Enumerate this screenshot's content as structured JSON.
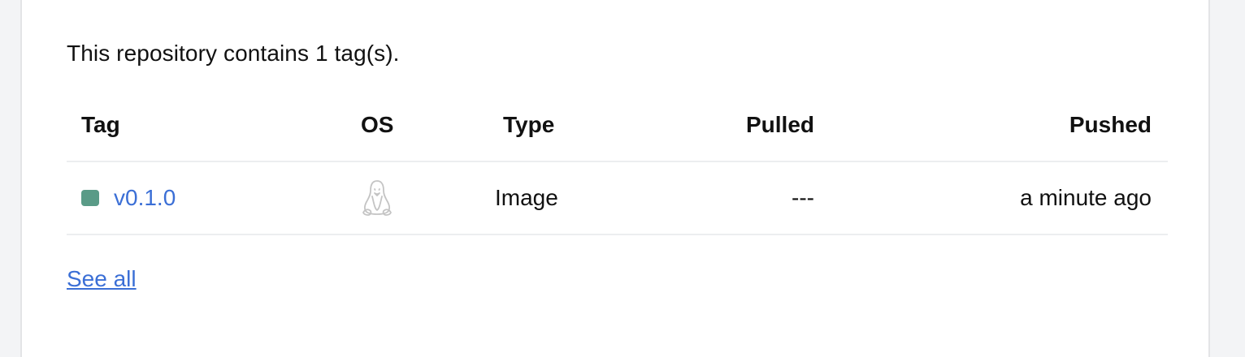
{
  "tags_section": {
    "summary": "This repository contains 1 tag(s).",
    "columns": {
      "tag": "Tag",
      "os": "OS",
      "type": "Type",
      "pulled": "Pulled",
      "pushed": "Pushed"
    },
    "rows": [
      {
        "tag": "v0.1.0",
        "status_color": "#5a9b87",
        "os_icon": "linux-tux-icon",
        "type": "Image",
        "pulled": "---",
        "pushed": "a minute ago"
      }
    ],
    "see_all_label": "See all"
  },
  "colors": {
    "link": "#3b6fd6",
    "divider": "#eceef0",
    "text": "#111111"
  }
}
